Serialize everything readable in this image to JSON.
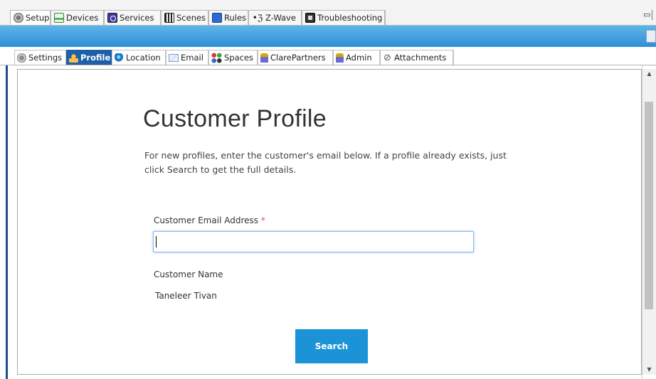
{
  "main_tabs": [
    {
      "label": "Setup",
      "icon": "setup-gear-icon",
      "active": true
    },
    {
      "label": "Devices",
      "icon": "devices-icon"
    },
    {
      "label": "Services",
      "icon": "services-icon"
    },
    {
      "label": "Scenes",
      "icon": "scenes-icon"
    },
    {
      "label": "Rules",
      "icon": "rules-icon"
    },
    {
      "label": "Z-Wave",
      "icon": "zwave-icon"
    },
    {
      "label": "Troubleshooting",
      "icon": "troubleshooting-icon"
    }
  ],
  "window_controls": {
    "minimize": "▭"
  },
  "sub_tabs": [
    {
      "label": "Settings",
      "icon": "settings-icon"
    },
    {
      "label": "Profile",
      "icon": "profile-icon",
      "active": true
    },
    {
      "label": "Location",
      "icon": "globe-icon"
    },
    {
      "label": "Email",
      "icon": "envelope-icon"
    },
    {
      "label": "Spaces",
      "icon": "spaces-icon"
    },
    {
      "label": "ClarePartners",
      "icon": "partner-person-icon"
    },
    {
      "label": "Admin",
      "icon": "admin-person-icon"
    },
    {
      "label": "Attachments",
      "icon": "paperclip-icon"
    }
  ],
  "profile": {
    "title": "Customer Profile",
    "description": "For new profiles, enter the customer's email below. If a profile already exists, just click Search to get the full details.",
    "email_label": "Customer Email Address",
    "required_mark": "*",
    "email_value": "",
    "name_label": "Customer Name",
    "name_value": "Taneleer Tivan",
    "search_label": "Search"
  },
  "colors": {
    "accent_blue": "#1b93d6",
    "active_subtab": "#1e5fa8",
    "required": "#d9534f"
  }
}
